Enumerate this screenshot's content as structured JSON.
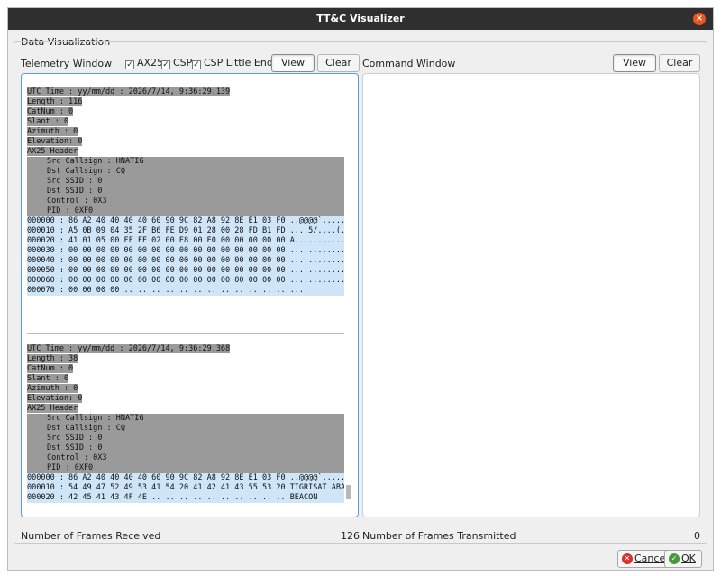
{
  "window": {
    "title": "TT&C Visualizer",
    "close_glyph": "×"
  },
  "group": {
    "title": "Data Visualization"
  },
  "telemetry": {
    "label": "Telemetry Window",
    "options": [
      {
        "label": "AX25",
        "checked": true
      },
      {
        "label": "CSP",
        "checked": true
      },
      {
        "label": "CSP Little Endian",
        "checked": true
      }
    ],
    "check_glyph": "✓",
    "view_label": "View",
    "clear_label": "Clear",
    "frames": [
      {
        "header": [
          "UTC Time : yy/mm/dd : 2026/7/14, 9:36:29.139",
          "Length : 116",
          "CatNum : 0",
          "Slant : 0",
          "Azimuth : 0",
          "Elevation: 0",
          "AX25 Header"
        ],
        "ax25": [
          "Src Callsign : HNATIG",
          "Dst Callsign : CQ",
          "Src SSID : 0",
          "Dst SSID : 0",
          "Control : 0X3",
          "PID : 0XF0"
        ],
        "hex": [
          "000000 : 86 A2 40 40 40 40 60 90 9C 82 A8 92 8E E1 03 F0 ..@@@@`........",
          "000010 : A5 0B 09 04 35 2F B6 FE D9 01 28 00 28 FD B1 FD ....5/....(.(...",
          "000020 : 41 01 05 00 FF FF 02 00 E8 00 E0 00 00 00 00 00 A...............",
          "000030 : 00 00 00 00 00 00 00 00 00 00 00 00 00 00 00 00 ................",
          "000040 : 00 00 00 00 00 00 00 00 00 00 00 00 00 00 00 00 ................",
          "000050 : 00 00 00 00 00 00 00 00 00 00 00 00 00 00 00 00 ................",
          "000060 : 00 00 00 00 00 00 00 00 00 00 00 00 00 00 00 00 ................",
          "000070 : 00 00 00 00 .. .. .. .. .. .. .. .. .. .. .. .. ...."
        ]
      },
      {
        "header": [
          "UTC Time : yy/mm/dd : 2026/7/14, 9:36:29.368",
          "Length : 38",
          "CatNum : 0",
          "Slant : 0",
          "Azimuth : 0",
          "Elevation: 0",
          "AX25 Header"
        ],
        "ax25": [
          "Src Callsign : HNATIG",
          "Dst Callsign : CQ",
          "Src SSID : 0",
          "Dst SSID : 0",
          "Control : 0X3",
          "PID : 0XF0"
        ],
        "hex": [
          "000000 : 86 A2 40 40 40 40 60 90 9C 82 A8 92 8E E1 03 F0 ..@@@@`........",
          "000010 : 54 49 47 52 49 53 41 54 20 41 42 41 43 55 53 20 TIGRISAT ABACUS",
          "000020 : 42 45 41 43 4F 4E .. .. .. .. .. .. .. .. .. .. BEACON"
        ]
      }
    ],
    "frames_received_label": "Number of Frames Received",
    "frames_received_count": "126"
  },
  "command": {
    "label": "Command Window",
    "view_label": "View",
    "clear_label": "Clear",
    "frames_transmitted_label": "Number of Frames Transmitted",
    "frames_transmitted_count": "0"
  },
  "dialog": {
    "cancel_label": "Cancel",
    "ok_label": "OK",
    "cancel_glyph": "✕",
    "ok_glyph": "✓"
  },
  "colors": {
    "titlebar": "#2f2f2f",
    "close": "#e95420",
    "header_row": "#9a9a9a",
    "hex_row": "#cfe6f8",
    "active_border": "#5aa0e0"
  }
}
